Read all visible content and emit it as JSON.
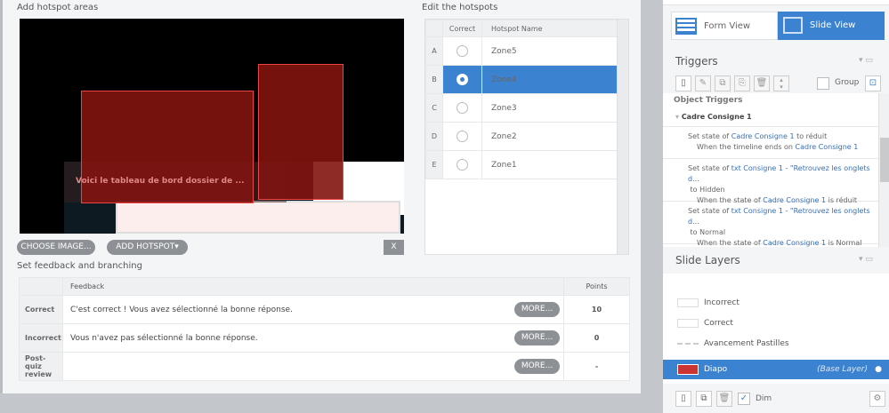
{
  "hotspot_area": {
    "title": "Add hotspot areas",
    "slide_text": "Voici le tableau de bord dossier de ...",
    "choose_image": "CHOOSE IMAGE...",
    "add_hotspot": "ADD HOTSPOT",
    "add_hotspot_caret": "▾",
    "delete": "X"
  },
  "hotspots": {
    "title": "Edit the hotspots",
    "col_correct": "Correct",
    "col_name": "Hotspot Name",
    "rows": [
      {
        "letter": "A",
        "name": "Zone5",
        "selected": false
      },
      {
        "letter": "B",
        "name": "Zone4",
        "selected": true
      },
      {
        "letter": "C",
        "name": "Zone3",
        "selected": false
      },
      {
        "letter": "D",
        "name": "Zone2",
        "selected": false
      },
      {
        "letter": "E",
        "name": "Zone1",
        "selected": false
      }
    ]
  },
  "feedback": {
    "title": "Set feedback and branching",
    "col_feedback": "Feedback",
    "col_points": "Points",
    "more": "MORE...",
    "rows": [
      {
        "label": "Correct",
        "text": "C'est correct !  Vous avez sélectionné la bonne réponse.",
        "points": "10"
      },
      {
        "label": "Incorrect",
        "text": "Vous n'avez pas sélectionné la bonne réponse.",
        "points": "0"
      },
      {
        "label": "Post-quiz review",
        "text": "",
        "points": "-"
      }
    ]
  },
  "views": {
    "form": "Form View",
    "slide": "Slide View"
  },
  "triggers": {
    "title": "Triggers",
    "group": "Group",
    "section": "Object Triggers",
    "object": "Cadre Consigne 1",
    "items": [
      {
        "a": "Set state of ",
        "b": "Cadre Consigne 1",
        "c": " to ",
        "d": "réduit",
        "w1": "When the timeline ends on ",
        "w2": "Cadre Consigne 1",
        "w3": ""
      },
      {
        "a": "Set state of ",
        "b": "txt Consigne 1 - \"Retrouvez les onglets d...",
        "c": "to ",
        "d": "Hidden",
        "w1": "When the state of ",
        "w2": "Cadre Consigne 1",
        "w3": " is réduit"
      },
      {
        "a": "Set state of ",
        "b": "txt Consigne 1 - \"Retrouvez les onglets d...",
        "c": "to ",
        "d": "Normal",
        "w1": "When the state of ",
        "w2": "Cadre Consigne 1",
        "w3": " is Normal"
      }
    ]
  },
  "layers": {
    "title": "Slide Layers",
    "items": [
      "Incorrect",
      "Correct",
      "Avancement Pastilles"
    ],
    "base": "Diapo",
    "base_tag": "(Base Layer)",
    "dim": "Dim"
  },
  "colors": {
    "accent": "#3b82d1",
    "hotspot": "#8b1a14"
  }
}
